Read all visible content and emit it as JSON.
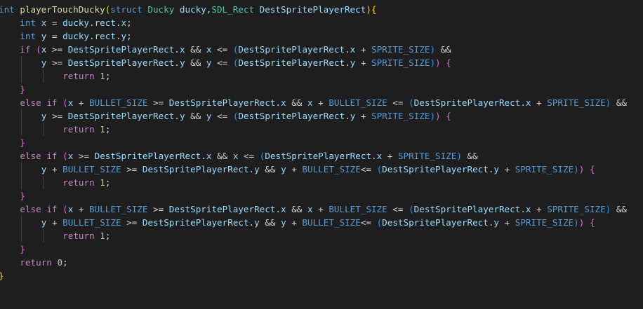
{
  "editor": {
    "theme_colors": {
      "background": "#1e1e1e",
      "keyword": "#569cd6",
      "control": "#c586c0",
      "function": "#dcdcaa",
      "type": "#4ec9b0",
      "variable": "#9cdcfe",
      "number": "#b5cea8",
      "bracket_gold": "#ffd700",
      "bracket_orchid": "#da70d6",
      "bracket_blue": "#179fff"
    },
    "lines": [
      {
        "indent": 0,
        "tokens": [
          {
            "t": "int",
            "c": "kw"
          },
          {
            "t": " "
          },
          {
            "t": "playerTouchDucky",
            "c": "fn"
          },
          {
            "t": "(",
            "c": "b1"
          },
          {
            "t": "struct",
            "c": "kw"
          },
          {
            "t": " "
          },
          {
            "t": "Ducky",
            "c": "type"
          },
          {
            "t": " "
          },
          {
            "t": "ducky",
            "c": "var"
          },
          {
            "t": ","
          },
          {
            "t": "SDL_Rect",
            "c": "type"
          },
          {
            "t": " "
          },
          {
            "t": "DestSpritePlayerRect",
            "c": "var"
          },
          {
            "t": ")",
            "c": "b1"
          },
          {
            "t": "{",
            "c": "b1"
          }
        ]
      },
      {
        "indent": 1,
        "tokens": [
          {
            "t": "int",
            "c": "kw"
          },
          {
            "t": " "
          },
          {
            "t": "x",
            "c": "var"
          },
          {
            "t": " = "
          },
          {
            "t": "ducky",
            "c": "var"
          },
          {
            "t": "."
          },
          {
            "t": "rect",
            "c": "var"
          },
          {
            "t": "."
          },
          {
            "t": "x",
            "c": "var"
          },
          {
            "t": ";"
          }
        ]
      },
      {
        "indent": 1,
        "tokens": [
          {
            "t": "int",
            "c": "kw"
          },
          {
            "t": " "
          },
          {
            "t": "y",
            "c": "var"
          },
          {
            "t": " = "
          },
          {
            "t": "ducky",
            "c": "var"
          },
          {
            "t": "."
          },
          {
            "t": "rect",
            "c": "var"
          },
          {
            "t": "."
          },
          {
            "t": "y",
            "c": "var"
          },
          {
            "t": ";"
          }
        ]
      },
      {
        "indent": 1,
        "tokens": [
          {
            "t": "if",
            "c": "ctl"
          },
          {
            "t": " "
          },
          {
            "t": "(",
            "c": "b2"
          },
          {
            "t": "x",
            "c": "var"
          },
          {
            "t": " >= "
          },
          {
            "t": "DestSpritePlayerRect",
            "c": "var"
          },
          {
            "t": "."
          },
          {
            "t": "x",
            "c": "var"
          },
          {
            "t": " && "
          },
          {
            "t": "x",
            "c": "var"
          },
          {
            "t": " <= "
          },
          {
            "t": "(",
            "c": "b3"
          },
          {
            "t": "DestSpritePlayerRect",
            "c": "var"
          },
          {
            "t": "."
          },
          {
            "t": "x",
            "c": "var"
          },
          {
            "t": " + "
          },
          {
            "t": "SPRITE_SIZE",
            "c": "macro"
          },
          {
            "t": ")",
            "c": "b3"
          },
          {
            "t": " &&"
          }
        ]
      },
      {
        "indent": 2,
        "tokens": [
          {
            "t": "y",
            "c": "var"
          },
          {
            "t": " >= "
          },
          {
            "t": "DestSpritePlayerRect",
            "c": "var"
          },
          {
            "t": "."
          },
          {
            "t": "y",
            "c": "var"
          },
          {
            "t": " && "
          },
          {
            "t": "y",
            "c": "var"
          },
          {
            "t": " <= "
          },
          {
            "t": "(",
            "c": "b3"
          },
          {
            "t": "DestSpritePlayerRect",
            "c": "var"
          },
          {
            "t": "."
          },
          {
            "t": "y",
            "c": "var"
          },
          {
            "t": " + "
          },
          {
            "t": "SPRITE_SIZE",
            "c": "macro"
          },
          {
            "t": ")",
            "c": "b3"
          },
          {
            "t": ")",
            "c": "b2"
          },
          {
            "t": " "
          },
          {
            "t": "{",
            "c": "b2"
          }
        ]
      },
      {
        "indent": 3,
        "tokens": [
          {
            "t": "return",
            "c": "ctl"
          },
          {
            "t": " "
          },
          {
            "t": "1",
            "c": "num"
          },
          {
            "t": ";"
          }
        ]
      },
      {
        "indent": 1,
        "tokens": [
          {
            "t": "}",
            "c": "b2"
          }
        ]
      },
      {
        "indent": 1,
        "tokens": [
          {
            "t": "else",
            "c": "ctl"
          },
          {
            "t": " "
          },
          {
            "t": "if",
            "c": "ctl"
          },
          {
            "t": " "
          },
          {
            "t": "(",
            "c": "b2"
          },
          {
            "t": "x",
            "c": "var"
          },
          {
            "t": " + "
          },
          {
            "t": "BULLET_SIZE",
            "c": "macro"
          },
          {
            "t": " >= "
          },
          {
            "t": "DestSpritePlayerRect",
            "c": "var"
          },
          {
            "t": "."
          },
          {
            "t": "x",
            "c": "var"
          },
          {
            "t": " && "
          },
          {
            "t": "x",
            "c": "var"
          },
          {
            "t": " + "
          },
          {
            "t": "BULLET_SIZE",
            "c": "macro"
          },
          {
            "t": " <= "
          },
          {
            "t": "(",
            "c": "b3"
          },
          {
            "t": "DestSpritePlayerRect",
            "c": "var"
          },
          {
            "t": "."
          },
          {
            "t": "x",
            "c": "var"
          },
          {
            "t": " + "
          },
          {
            "t": "SPRITE_SIZE",
            "c": "macro"
          },
          {
            "t": ")",
            "c": "b3"
          },
          {
            "t": " &&"
          }
        ]
      },
      {
        "indent": 2,
        "tokens": [
          {
            "t": "y",
            "c": "var"
          },
          {
            "t": " >= "
          },
          {
            "t": "DestSpritePlayerRect",
            "c": "var"
          },
          {
            "t": "."
          },
          {
            "t": "y",
            "c": "var"
          },
          {
            "t": " && "
          },
          {
            "t": "y",
            "c": "var"
          },
          {
            "t": " <= "
          },
          {
            "t": "(",
            "c": "b3"
          },
          {
            "t": "DestSpritePlayerRect",
            "c": "var"
          },
          {
            "t": "."
          },
          {
            "t": "y",
            "c": "var"
          },
          {
            "t": " + "
          },
          {
            "t": "SPRITE_SIZE",
            "c": "macro"
          },
          {
            "t": ")",
            "c": "b3"
          },
          {
            "t": ")",
            "c": "b2"
          },
          {
            "t": " "
          },
          {
            "t": "{",
            "c": "b2"
          }
        ]
      },
      {
        "indent": 3,
        "tokens": [
          {
            "t": "return",
            "c": "ctl"
          },
          {
            "t": " "
          },
          {
            "t": "1",
            "c": "num"
          },
          {
            "t": ";"
          }
        ]
      },
      {
        "indent": 1,
        "tokens": [
          {
            "t": "}",
            "c": "b2"
          }
        ]
      },
      {
        "indent": 1,
        "tokens": [
          {
            "t": "else",
            "c": "ctl"
          },
          {
            "t": " "
          },
          {
            "t": "if",
            "c": "ctl"
          },
          {
            "t": " "
          },
          {
            "t": "(",
            "c": "b2"
          },
          {
            "t": "x",
            "c": "var"
          },
          {
            "t": " >= "
          },
          {
            "t": "DestSpritePlayerRect",
            "c": "var"
          },
          {
            "t": "."
          },
          {
            "t": "x",
            "c": "var"
          },
          {
            "t": " && "
          },
          {
            "t": "x",
            "c": "var"
          },
          {
            "t": " <= "
          },
          {
            "t": "(",
            "c": "b3"
          },
          {
            "t": "DestSpritePlayerRect",
            "c": "var"
          },
          {
            "t": "."
          },
          {
            "t": "x",
            "c": "var"
          },
          {
            "t": " + "
          },
          {
            "t": "SPRITE_SIZE",
            "c": "macro"
          },
          {
            "t": ")",
            "c": "b3"
          },
          {
            "t": " &&"
          }
        ]
      },
      {
        "indent": 2,
        "tokens": [
          {
            "t": "y",
            "c": "var"
          },
          {
            "t": " + "
          },
          {
            "t": "BULLET_SIZE",
            "c": "macro"
          },
          {
            "t": " >= "
          },
          {
            "t": "DestSpritePlayerRect",
            "c": "var"
          },
          {
            "t": "."
          },
          {
            "t": "y",
            "c": "var"
          },
          {
            "t": " && "
          },
          {
            "t": "y",
            "c": "var"
          },
          {
            "t": " + "
          },
          {
            "t": "BULLET_SIZE",
            "c": "macro"
          },
          {
            "t": "<= "
          },
          {
            "t": "(",
            "c": "b3"
          },
          {
            "t": "DestSpritePlayerRect",
            "c": "var"
          },
          {
            "t": "."
          },
          {
            "t": "y",
            "c": "var"
          },
          {
            "t": " + "
          },
          {
            "t": "SPRITE_SIZE",
            "c": "macro"
          },
          {
            "t": ")",
            "c": "b3"
          },
          {
            "t": ")",
            "c": "b2"
          },
          {
            "t": " "
          },
          {
            "t": "{",
            "c": "b2"
          }
        ]
      },
      {
        "indent": 3,
        "tokens": [
          {
            "t": "return",
            "c": "ctl"
          },
          {
            "t": " "
          },
          {
            "t": "1",
            "c": "num"
          },
          {
            "t": ";"
          }
        ]
      },
      {
        "indent": 1,
        "tokens": [
          {
            "t": "}",
            "c": "b2"
          }
        ]
      },
      {
        "indent": 1,
        "tokens": [
          {
            "t": "else",
            "c": "ctl"
          },
          {
            "t": " "
          },
          {
            "t": "if",
            "c": "ctl"
          },
          {
            "t": " "
          },
          {
            "t": "(",
            "c": "b2"
          },
          {
            "t": "x",
            "c": "var"
          },
          {
            "t": " + "
          },
          {
            "t": "BULLET_SIZE",
            "c": "macro"
          },
          {
            "t": " >= "
          },
          {
            "t": "DestSpritePlayerRect",
            "c": "var"
          },
          {
            "t": "."
          },
          {
            "t": "x",
            "c": "var"
          },
          {
            "t": " && "
          },
          {
            "t": "x",
            "c": "var"
          },
          {
            "t": " + "
          },
          {
            "t": "BULLET_SIZE",
            "c": "macro"
          },
          {
            "t": " <= "
          },
          {
            "t": "(",
            "c": "b3"
          },
          {
            "t": "DestSpritePlayerRect",
            "c": "var"
          },
          {
            "t": "."
          },
          {
            "t": "x",
            "c": "var"
          },
          {
            "t": " + "
          },
          {
            "t": "SPRITE_SIZE",
            "c": "macro"
          },
          {
            "t": ")",
            "c": "b3"
          },
          {
            "t": " &&"
          }
        ]
      },
      {
        "indent": 2,
        "tokens": [
          {
            "t": "y",
            "c": "var"
          },
          {
            "t": " + "
          },
          {
            "t": "BULLET_SIZE",
            "c": "macro"
          },
          {
            "t": " >= "
          },
          {
            "t": "DestSpritePlayerRect",
            "c": "var"
          },
          {
            "t": "."
          },
          {
            "t": "y",
            "c": "var"
          },
          {
            "t": " && "
          },
          {
            "t": "y",
            "c": "var"
          },
          {
            "t": " + "
          },
          {
            "t": "BULLET_SIZE",
            "c": "macro"
          },
          {
            "t": "<= "
          },
          {
            "t": "(",
            "c": "b3"
          },
          {
            "t": "DestSpritePlayerRect",
            "c": "var"
          },
          {
            "t": "."
          },
          {
            "t": "y",
            "c": "var"
          },
          {
            "t": " + "
          },
          {
            "t": "SPRITE_SIZE",
            "c": "macro"
          },
          {
            "t": ")",
            "c": "b3"
          },
          {
            "t": ")",
            "c": "b2"
          },
          {
            "t": " "
          },
          {
            "t": "{",
            "c": "b2"
          }
        ]
      },
      {
        "indent": 3,
        "tokens": [
          {
            "t": "return",
            "c": "ctl"
          },
          {
            "t": " "
          },
          {
            "t": "1",
            "c": "num"
          },
          {
            "t": ";"
          }
        ]
      },
      {
        "indent": 1,
        "tokens": [
          {
            "t": "}",
            "c": "b2"
          }
        ]
      },
      {
        "indent": 1,
        "tokens": [
          {
            "t": "return",
            "c": "ctl"
          },
          {
            "t": " "
          },
          {
            "t": "0",
            "c": "num"
          },
          {
            "t": ";"
          }
        ]
      },
      {
        "indent": 0,
        "tokens": [
          {
            "t": "}",
            "c": "b1"
          }
        ]
      }
    ]
  }
}
